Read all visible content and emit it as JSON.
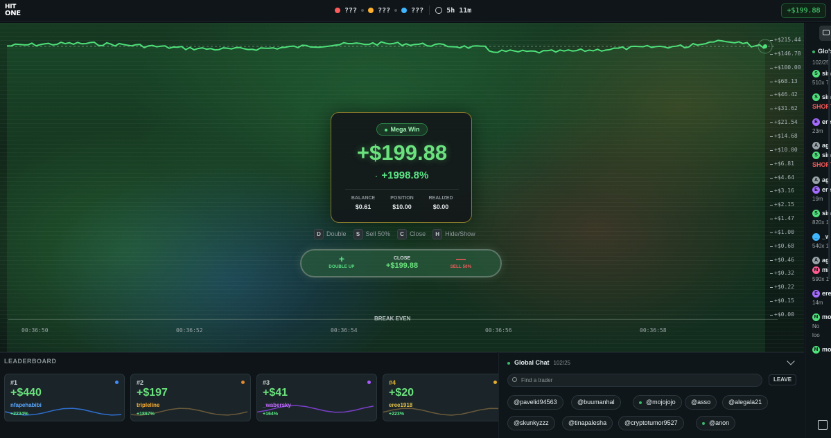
{
  "app": {
    "logo_line1": "HIT",
    "logo_line2": "ONE"
  },
  "topbar": {
    "players": [
      {
        "label": "???",
        "color": "#ff5b5b"
      },
      {
        "label": "???",
        "color": "#ffb02e"
      },
      {
        "label": "???",
        "color": "#3fb6ff"
      }
    ],
    "timer": "5h 11m",
    "balance": "+$199.88"
  },
  "chart": {
    "y_ticks": [
      "+$215.44",
      "+$146.78",
      "+$100.00",
      "+$68.13",
      "+$46.42",
      "+$31.62",
      "+$21.54",
      "+$14.68",
      "+$10.00",
      "+$6.81",
      "+$4.64",
      "+$3.16",
      "+$2.15",
      "+$1.47",
      "+$1.00",
      "+$0.68",
      "+$0.46",
      "+$0.32",
      "+$0.22",
      "+$0.15",
      "+$0.00"
    ],
    "x_ticks": [
      "00:36:50",
      "00:36:52",
      "00:36:54",
      "00:36:56",
      "00:36:58"
    ],
    "break_even_label": "BREAK EVEN",
    "line_color": "#4ee07a"
  },
  "result_card": {
    "badge": "Mega Win",
    "amount": "+$199.88",
    "pct_prefix": "-",
    "pct": "+1998.8%",
    "stats": [
      {
        "label": "BALANCE",
        "value": "$0.61"
      },
      {
        "label": "POSITION",
        "value": "$10.00"
      },
      {
        "label": "REALIZED",
        "value": "$0.00"
      }
    ]
  },
  "hotkeys": [
    {
      "key": "D",
      "label": "Double"
    },
    {
      "key": "S",
      "label": "Sell 50%"
    },
    {
      "key": "C",
      "label": "Close"
    },
    {
      "key": "H",
      "label": "Hide/Show"
    }
  ],
  "actions": {
    "double_icon": "+",
    "double_label": "DOUBLE UP",
    "close_label": "CLOSE",
    "close_value": "+$199.88",
    "sell_icon": "—",
    "sell_label": "SELL 50%"
  },
  "leaderboard": {
    "title": "LEADERBOARD",
    "entries": [
      {
        "rank": "#1",
        "amount": "+$440",
        "name": "nfapehabibi",
        "pct": "+2234%",
        "name_color": "#5aa7ff",
        "dot": "#3f8cff",
        "spark": "#2f6fd0"
      },
      {
        "rank": "#2",
        "amount": "+$197",
        "name": "tripleline",
        "pct": "+1897%",
        "name_color": "#ffb02e",
        "dot": "#e28a2e",
        "spark": "#6b5a3a"
      },
      {
        "rank": "#3",
        "amount": "+$41",
        "name": "_wabersky",
        "pct": "+164%",
        "name_color": "#c36bff",
        "dot": "#a95bff",
        "spark": "#7a3fc8"
      },
      {
        "rank": "#4",
        "amount": "+$20",
        "name": "eree1918",
        "pct": "+223%",
        "name_color": "#e0c04a",
        "dot": "#e0b02c",
        "spark": "#6b5a3a"
      }
    ]
  },
  "global_chat": {
    "title": "Global Chat",
    "count": "102/25",
    "search_placeholder": "Find a trader",
    "leave_label": "LEAVE",
    "chips": [
      "@pavelid94563",
      "@buumanhal",
      "@mojojojo",
      "@asso",
      "@alegala21",
      "@skunkyzzz",
      "@tinapalesha",
      "@cryptotumor9527",
      "@anon"
    ]
  },
  "side_chat": {
    "title": "Glob",
    "count": "102/25",
    "rows": [
      {
        "avatar": "S",
        "color": "#4ee07a",
        "text": "sin"
      },
      {
        "sub": "510x 7"
      },
      {
        "avatar": "S",
        "color": "#4ee07a",
        "text": "sin"
      },
      {
        "short": "SHORT"
      },
      {
        "avatar": "E",
        "color": "#a56bff",
        "text": "ere"
      },
      {
        "sub": "23m"
      },
      {
        "avatar": "A",
        "color": "#9aa4a8",
        "text": "ag"
      },
      {
        "avatar": "S",
        "color": "#4ee07a",
        "text": "sin"
      },
      {
        "short": "SHORT"
      },
      {
        "avatar": "A",
        "color": "#9aa4a8",
        "text": "ag"
      },
      {
        "avatar": "E",
        "color": "#a56bff",
        "text": "ere"
      },
      {
        "sub": "19m"
      },
      {
        "avatar": "S",
        "color": "#4ee07a",
        "text": "sin"
      },
      {
        "sub": "820x 1"
      },
      {
        "avatar": "_",
        "color": "#3fb6ff",
        "text": "_w"
      },
      {
        "sub": "540x 1"
      },
      {
        "avatar": "A",
        "color": "#9aa4a8",
        "text": "ag"
      },
      {
        "avatar": "M",
        "color": "#ff5b8f",
        "text": "mi"
      },
      {
        "sub": "590x 1"
      },
      {
        "avatar": "E",
        "color": "#a56bff",
        "text": "ere"
      },
      {
        "sub": "14m"
      },
      {
        "avatar": "M",
        "color": "#4ee07a",
        "text": "mo"
      },
      {
        "sub": "No"
      },
      {
        "sub": "loo"
      },
      {
        "avatar": "M",
        "color": "#4ee07a",
        "text": "mo"
      }
    ]
  }
}
